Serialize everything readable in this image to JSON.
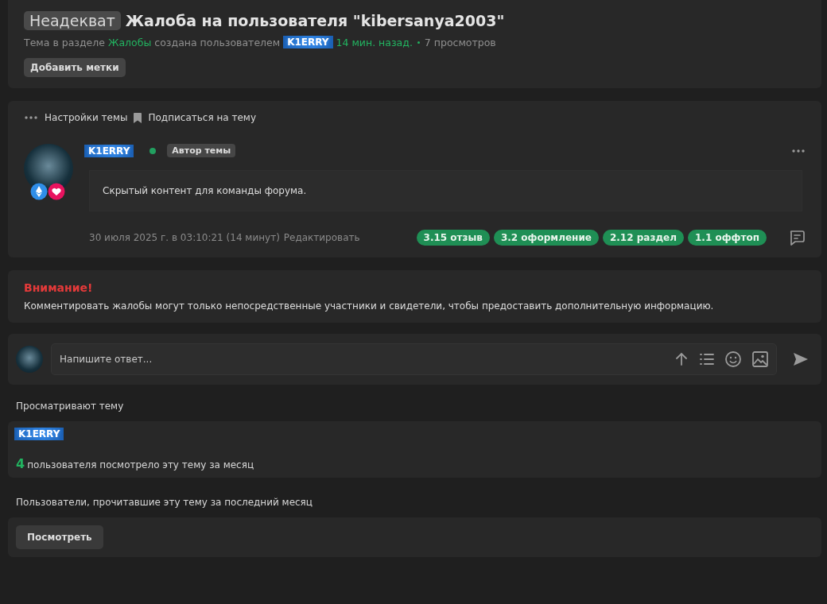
{
  "thread": {
    "prefix": "Неадекват",
    "title": "Жалоба на пользователя \"kibersanya2003\"",
    "meta": {
      "before": "Тема в разделе",
      "section": "Жалобы",
      "middle": "создана пользователем",
      "author": "K1ERRY",
      "time": "14 мин. назад.",
      "views": "7 просмотров"
    },
    "add_tags_button": "Добавить метки"
  },
  "toolbar": [
    {
      "kind": "dots",
      "label": "Настройки темы"
    },
    {
      "kind": "bookmark",
      "label": "Подписаться на тему"
    }
  ],
  "post": {
    "author": "K1ERRY",
    "online": true,
    "badge": "Автор темы",
    "content": "Скрытый контент для команды форума.",
    "date": "30 июля 2025 г. в 03:10:21 (14 минут)",
    "edit": "Редактировать",
    "tags": [
      {
        "label": "3.15 отзыв"
      },
      {
        "label": "3.2 оформление"
      },
      {
        "label": "2.12 раздел"
      },
      {
        "label": "1.1 оффтоп"
      }
    ]
  },
  "notice": {
    "title": "Внимание!",
    "text": "Комментировать жалобы могут только непосредственные участники и свидетели, чтобы предоставить дополнительную информацию."
  },
  "reply": {
    "placeholder": "Напишите ответ..."
  },
  "viewing": {
    "heading": "Просматривают тему",
    "users": [
      "K1ERRY"
    ],
    "count": "4",
    "count_text": "пользователя посмотрело эту тему за месяц"
  },
  "readers": {
    "heading": "Пользователи, прочитавшие эту тему за последний месяц",
    "button": "Посмотреть"
  }
}
